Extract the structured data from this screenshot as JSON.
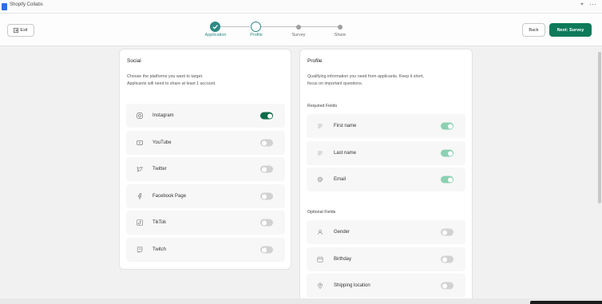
{
  "window": {
    "title": "Shopify Collabs",
    "pin_icon": "pin-icon",
    "more_icon": "more-icon"
  },
  "header": {
    "exit_label": "Exit",
    "back_label": "Back",
    "next_label": "Next: Survey",
    "next_color": "#0d7a5a"
  },
  "steps": [
    {
      "label": "Application",
      "state": "completed"
    },
    {
      "label": "Profile",
      "state": "current"
    },
    {
      "label": "Survey",
      "state": "upcoming"
    },
    {
      "label": "Share",
      "state": "upcoming"
    }
  ],
  "social": {
    "title": "Social",
    "desc_line1": "Choose the platforms you want to target.",
    "desc_line2": "Applicants will need to share at least 1 account.",
    "platforms": [
      {
        "label": "Instagram",
        "icon": "instagram-icon",
        "enabled": true
      },
      {
        "label": "YouTube",
        "icon": "youtube-icon",
        "enabled": false
      },
      {
        "label": "Twitter",
        "icon": "twitter-icon",
        "enabled": false
      },
      {
        "label": "Facebook Page",
        "icon": "facebook-icon",
        "enabled": false
      },
      {
        "label": "TikTok",
        "icon": "tiktok-icon",
        "enabled": false
      },
      {
        "label": "Twitch",
        "icon": "twitch-icon",
        "enabled": false
      }
    ]
  },
  "profile": {
    "title": "Profile",
    "desc_line1": "Qualifying information you need from applicants. Keep it short,",
    "desc_line2": "focus on important questions.",
    "required_label": "Required Fields",
    "required": [
      {
        "label": "First name",
        "icon": "text-lines-icon",
        "enabled": true
      },
      {
        "label": "Last name",
        "icon": "text-lines-icon",
        "enabled": true
      },
      {
        "label": "Email",
        "icon": "at-icon",
        "enabled": true
      }
    ],
    "optional_label": "Optional Fields",
    "optional": [
      {
        "label": "Gender",
        "icon": "person-icon",
        "enabled": false
      },
      {
        "label": "Birthday",
        "icon": "calendar-icon",
        "enabled": false
      },
      {
        "label": "Shipping location",
        "icon": "location-pin-icon",
        "enabled": false
      }
    ]
  }
}
